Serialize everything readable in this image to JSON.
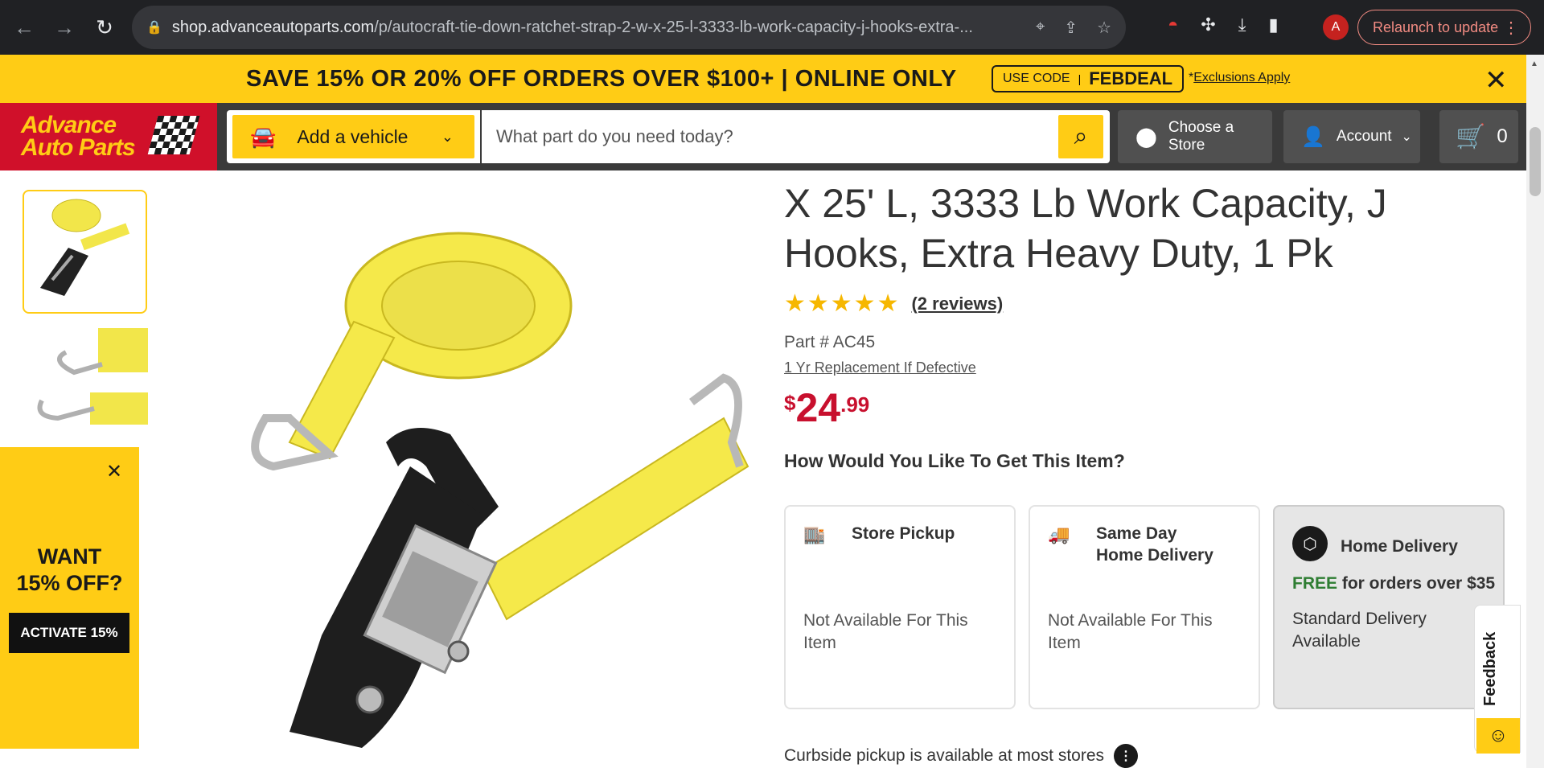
{
  "browser": {
    "url_host": "shop.advanceautoparts.com",
    "url_path": "/p/autocraft-tie-down-ratchet-strap-2-w-x-25-l-3333-lb-work-capacity-j-hooks-extra-...",
    "profile_initial": "A",
    "relaunch_label": "Relaunch to update"
  },
  "promo_bar": {
    "message": "SAVE 15% OR 20% OFF ORDERS OVER $100+ | ONLINE ONLY",
    "code_label": "USE CODE",
    "code_sep": "|",
    "code": "FEBDEAL",
    "exclusions_prefix": "*",
    "exclusions_link": "Exclusions Apply"
  },
  "header": {
    "logo_line1": "Advance",
    "logo_line2": "Auto Parts",
    "vehicle_label": "Add a vehicle",
    "search_placeholder": "What part do you need today?",
    "store_label": "Choose a Store",
    "account_label": "Account",
    "cart_count": "0"
  },
  "side_promo": {
    "headline_1": "WANT",
    "headline_2": "15% OFF?",
    "button_label": "ACTIVATE 15%"
  },
  "product": {
    "title": "X 25' L, 3333 Lb Work Capacity, J Hooks, Extra Heavy Duty, 1 Pk",
    "stars": "★★★★★",
    "rating": 5,
    "reviews_label": "(2 reviews)",
    "part_number": "Part # AC45",
    "warranty": "1 Yr Replacement If Defective",
    "price_currency": "$",
    "price_dollars": "24",
    "price_cents": ".99",
    "fulfillment_heading": "How Would You Like To Get This Item?"
  },
  "fulfillment": {
    "store_pickup": {
      "title": "Store Pickup",
      "status": "Not Available For This Item"
    },
    "same_day": {
      "title_1": "Same Day",
      "title_2": "Home Delivery",
      "status": "Not Available For This Item"
    },
    "home_delivery": {
      "title": "Home Delivery",
      "free_word": "FREE",
      "free_rest": " for orders over $35",
      "status_1": "Standard Delivery",
      "status_2": "Available"
    }
  },
  "curbside_text": "Curbside pickup is available at most stores",
  "feedback_label": "Feedback",
  "colors": {
    "brand_yellow": "#ffcc15",
    "brand_red": "#d0102a",
    "price_red": "#c8102e",
    "header_gray": "#3a3a3a"
  }
}
